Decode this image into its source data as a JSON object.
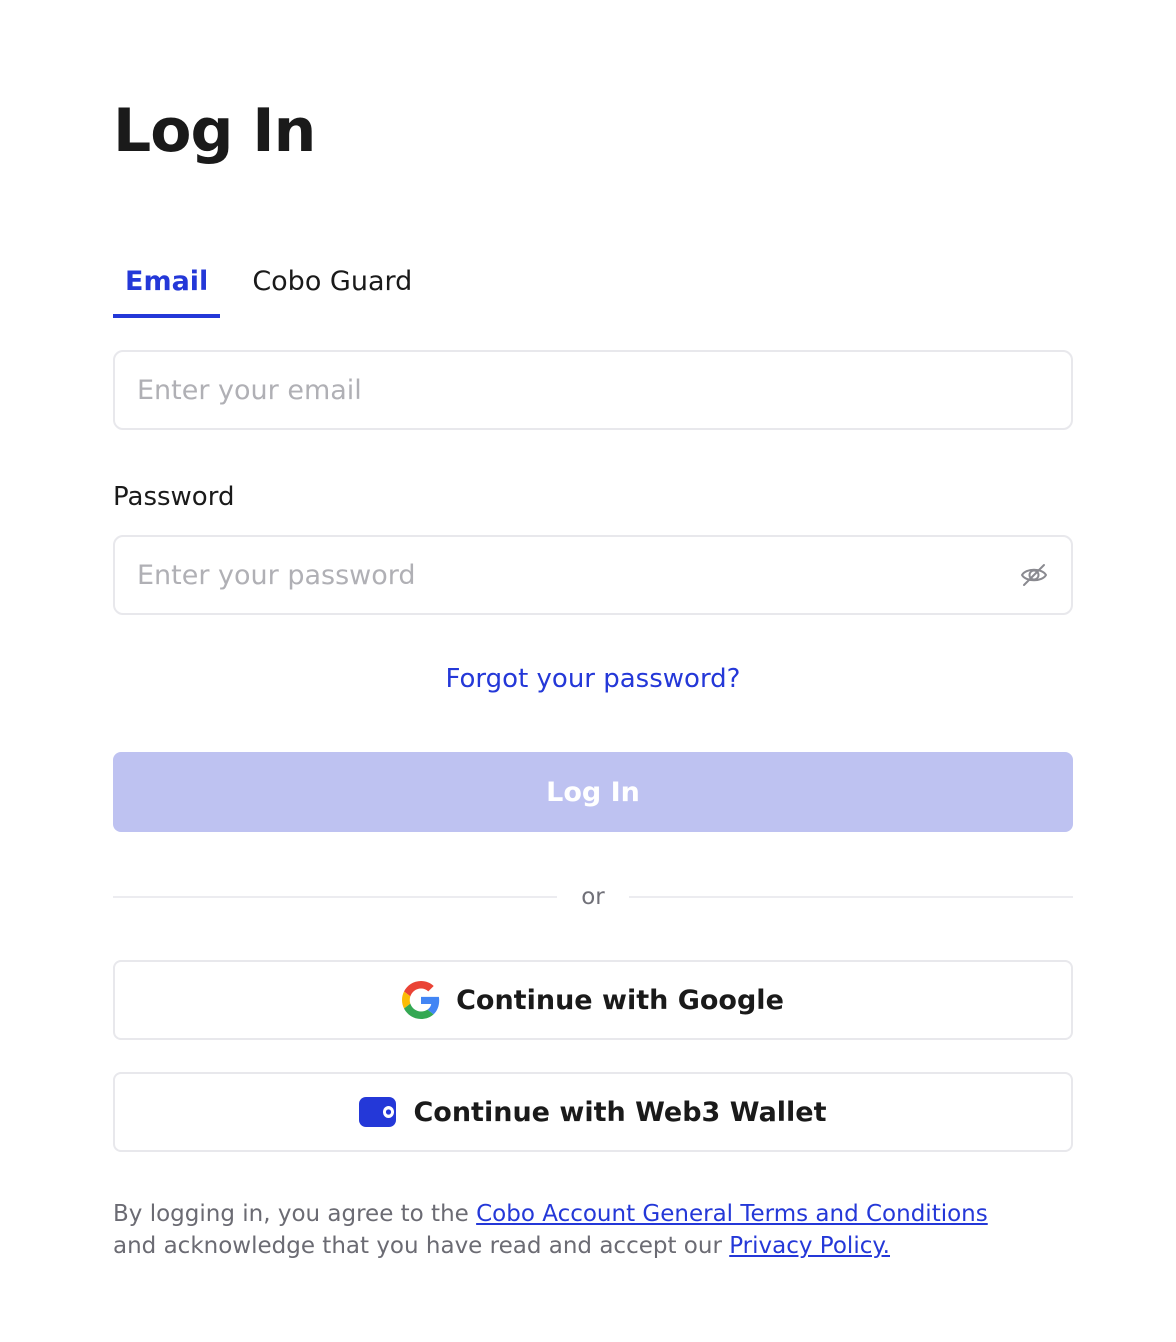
{
  "page_title": "Log In",
  "tabs": [
    {
      "label": "Email",
      "active": true
    },
    {
      "label": "Cobo Guard",
      "active": false
    }
  ],
  "email": {
    "placeholder": "Enter your email",
    "value": ""
  },
  "password": {
    "label": "Password",
    "placeholder": "Enter your password",
    "value": "",
    "toggle_icon": "eye-off-icon"
  },
  "forgot_password": "Forgot your password?",
  "login_button": "Log In",
  "divider_text": "or",
  "social": {
    "google_label": "Continue with Google",
    "wallet_label": "Continue with Web3 Wallet"
  },
  "terms": {
    "prefix": "By logging in, you agree to the",
    "terms_link": "Cobo Account General Terms and Conditions",
    "middle": "and acknowledge that you have read and accept our",
    "privacy_link": "Privacy Policy."
  },
  "colors": {
    "accent": "#2438d8",
    "button_disabled": "#bec2f1",
    "border": "#e8e8ec"
  }
}
